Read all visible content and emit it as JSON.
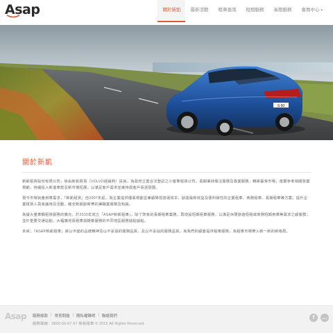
{
  "brand": {
    "logo_text": "Asap"
  },
  "nav": {
    "items": [
      {
        "label": "關於新凱",
        "active": true
      },
      {
        "label": "最新活動",
        "active": false
      },
      {
        "label": "租車查詢",
        "active": false
      },
      {
        "label": "短租服務",
        "active": false
      },
      {
        "label": "長租服務",
        "active": false
      },
      {
        "label": "會員中心",
        "active": false
      }
    ],
    "member_caret": "▾"
  },
  "hero": {
    "icon": "car-hero-image",
    "plate_text": "S 60"
  },
  "about": {
    "title": "關於新凱",
    "paragraphs": [
      "新凱租賃股份有限公司，係由新凱貿易（VOLVO經銷商）投資，為政府立案合法登記之小客車租賃公司。長期秉持專注服務及專業服務，精耕臺灣市場，落實參考相關營業規範，持續投入新進車款及新市場拓展，以滿足客戶需求並維持與客戶長遠發展。",
      "現今市場資產用車需求，「新凱租賃」自2007年起，為企業提供優異規劃並兼顧降低營運成本、創造最新效益及便利彈性的企業租車、商務租車、長期租車等方案，提升企業租賃人員會議用及活動，確全新穎創新帶的兼職業服務及知識。",
      "為讓大量車輛租賃服務的擴充，於2015年成立「ASAP新凱租車」，除了既有的長期租車業務，再增設短期租車服務，以滿足休閒旅遊短租或商務短期用車等需求之顧客群；並於重要交通站點，大幅擴增長租車與轉乘服務的不同地區服務據點據點。",
      "未來，「ASAP新凱租車」將以不變的品牌精神及以不妥協的服務品質，及以不妥協的服務品質，為我們的顧客提供租車服務，為租車市場帶入新一新的新格局。"
    ]
  },
  "footer": {
    "logo_text": "Asap",
    "links": [
      "服務條款",
      "常見問題",
      "隱私權聲明",
      "聯絡我們"
    ],
    "copyright": "服務專線：0800-50-67-67 新凱租車 © 2015 All Rights Reserved.",
    "social": [
      {
        "icon": "facebook-icon",
        "glyph": "f"
      },
      {
        "icon": "line-icon",
        "glyph": "…"
      }
    ]
  },
  "colors": {
    "accent": "#e05a36",
    "footer_bg": "#f2f2f2",
    "text": "#6a6a6a"
  }
}
